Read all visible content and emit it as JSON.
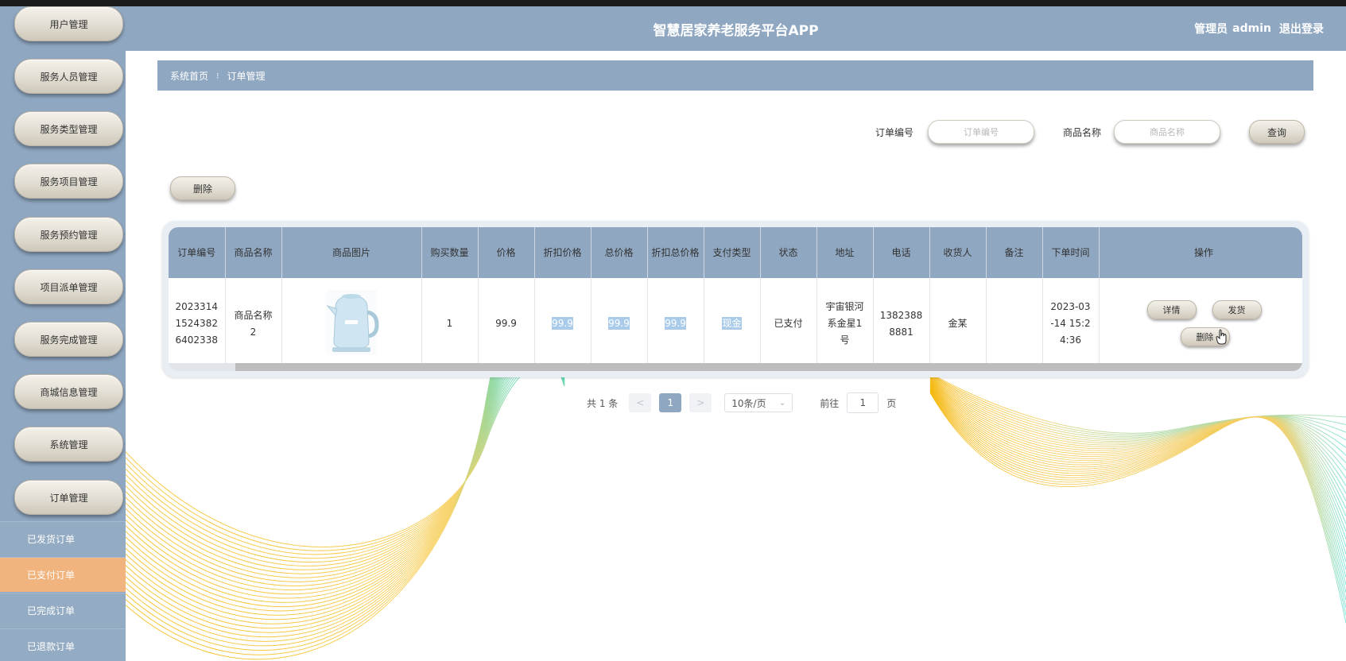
{
  "header": {
    "app_title": "智慧居家养老服务平台APP",
    "user_role": "管理员",
    "username": "admin",
    "logout_label": "退出登录"
  },
  "sidebar": {
    "menu_items": [
      {
        "label": "用户管理"
      },
      {
        "label": "服务人员管理"
      },
      {
        "label": "服务类型管理"
      },
      {
        "label": "服务项目管理"
      },
      {
        "label": "服务预约管理"
      },
      {
        "label": "项目派单管理"
      },
      {
        "label": "服务完成管理"
      },
      {
        "label": "商城信息管理"
      },
      {
        "label": "系统管理"
      },
      {
        "label": "订单管理"
      }
    ],
    "sub_items": [
      {
        "label": "已发货订单",
        "active": false
      },
      {
        "label": "已支付订单",
        "active": true
      },
      {
        "label": "已完成订单",
        "active": false
      },
      {
        "label": "已退款订单",
        "active": false
      }
    ]
  },
  "breadcrumb": {
    "home": "系统首页",
    "separator": "⁝",
    "current": "订单管理"
  },
  "search": {
    "order_no_label": "订单编号",
    "order_no_placeholder": "订单编号",
    "product_name_label": "商品名称",
    "product_name_placeholder": "商品名称",
    "query_button": "查询"
  },
  "toolbar": {
    "delete_button": "删除"
  },
  "table": {
    "headers": [
      "订单编号",
      "商品名称",
      "商品图片",
      "购买数量",
      "价格",
      "折扣价格",
      "总价格",
      "折扣总价格",
      "支付类型",
      "状态",
      "地址",
      "电话",
      "收货人",
      "备注",
      "下单时间",
      "操作"
    ],
    "rows": [
      {
        "order_no": "20233141524382 6402338",
        "order_no_lines": [
          "2023314",
          "1524382",
          "6402338"
        ],
        "product_name_lines": [
          "商品名称",
          "2"
        ],
        "quantity": "1",
        "price": "99.9",
        "discount_price": "99.9",
        "total_price": "99.9",
        "discount_total": "99.9",
        "payment_type": "现金",
        "status": "已支付",
        "address_lines": [
          "宇宙银河",
          "系金星1",
          "号"
        ],
        "phone_lines": [
          "1382388",
          "8881"
        ],
        "receiver": "金某",
        "remark": "",
        "order_time_lines": [
          "2023-03",
          "-14 15:2",
          "4:36"
        ],
        "actions": {
          "detail": "详情",
          "ship": "发货",
          "delete": "删除"
        }
      }
    ]
  },
  "pagination": {
    "total_text": "共 1 条",
    "prev": "<",
    "current_page": "1",
    "next": ">",
    "page_size": "10条/页",
    "goto_label": "前往",
    "goto_value": "1",
    "page_suffix": "页"
  },
  "colors": {
    "primary": "#8fa7c1",
    "active_sub": "#f2b47f",
    "highlight": "#a9cbe9"
  }
}
